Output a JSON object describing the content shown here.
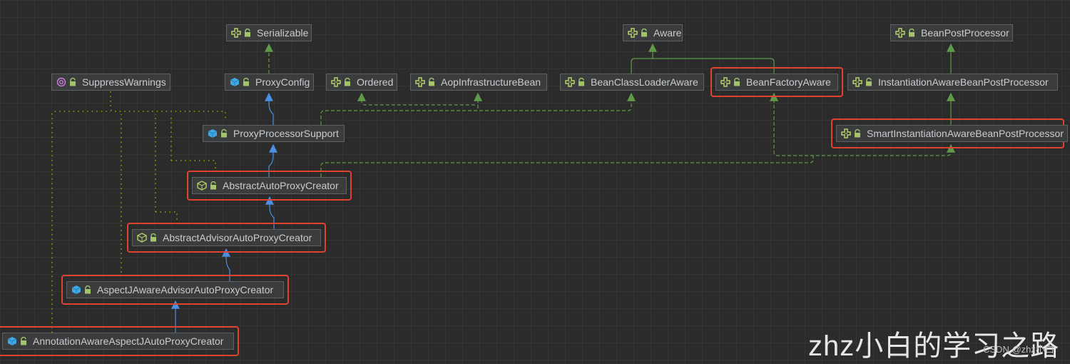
{
  "nodes": [
    {
      "id": "serializable",
      "label": "Serializable",
      "kind": "interface"
    },
    {
      "id": "aware",
      "label": "Aware",
      "kind": "interface"
    },
    {
      "id": "beanpostprocessor",
      "label": "BeanPostProcessor",
      "kind": "interface"
    },
    {
      "id": "suppresswarnings",
      "label": "SuppressWarnings",
      "kind": "annotation"
    },
    {
      "id": "proxyconfig",
      "label": "ProxyConfig",
      "kind": "class"
    },
    {
      "id": "ordered",
      "label": "Ordered",
      "kind": "interface"
    },
    {
      "id": "aopinfrastructurebean",
      "label": "AopInfrastructureBean",
      "kind": "interface"
    },
    {
      "id": "beanclassloaderaware",
      "label": "BeanClassLoaderAware",
      "kind": "interface"
    },
    {
      "id": "beanfactoryaware",
      "label": "BeanFactoryAware",
      "kind": "interface",
      "highlighted": true
    },
    {
      "id": "instantiationawarebeanpostprocessor",
      "label": "InstantiationAwareBeanPostProcessor",
      "kind": "interface"
    },
    {
      "id": "proxyprocessorsupport",
      "label": "ProxyProcessorSupport",
      "kind": "class"
    },
    {
      "id": "smartinstantiationawarebeanpostprocessor",
      "label": "SmartInstantiationAwareBeanPostProcessor",
      "kind": "interface",
      "highlighted": true
    },
    {
      "id": "abstractautoproxycreator",
      "label": "AbstractAutoProxyCreator",
      "kind": "abstract",
      "highlighted": true
    },
    {
      "id": "abstractadvisorautoproxycreator",
      "label": "AbstractAdvisorAutoProxyCreator",
      "kind": "abstract",
      "highlighted": true
    },
    {
      "id": "aspectjawareadvisorautoproxycreator",
      "label": "AspectJAwareAdvisorAutoProxyCreator",
      "kind": "class",
      "highlighted": true
    },
    {
      "id": "annotationawareaspectjautoproxycreator",
      "label": "AnnotationAwareAspectJAutoProxyCreator",
      "kind": "class",
      "highlighted": true
    }
  ],
  "colors": {
    "background": "#2b2b2b",
    "highlight": "#e0422e",
    "extends": "#4a8fe0",
    "implements": "#5e9a4a",
    "annotation_link": "#b0a800"
  },
  "watermark": {
    "main": "zhz小白的学习之路",
    "sub": "CSDN @zhz小白"
  }
}
